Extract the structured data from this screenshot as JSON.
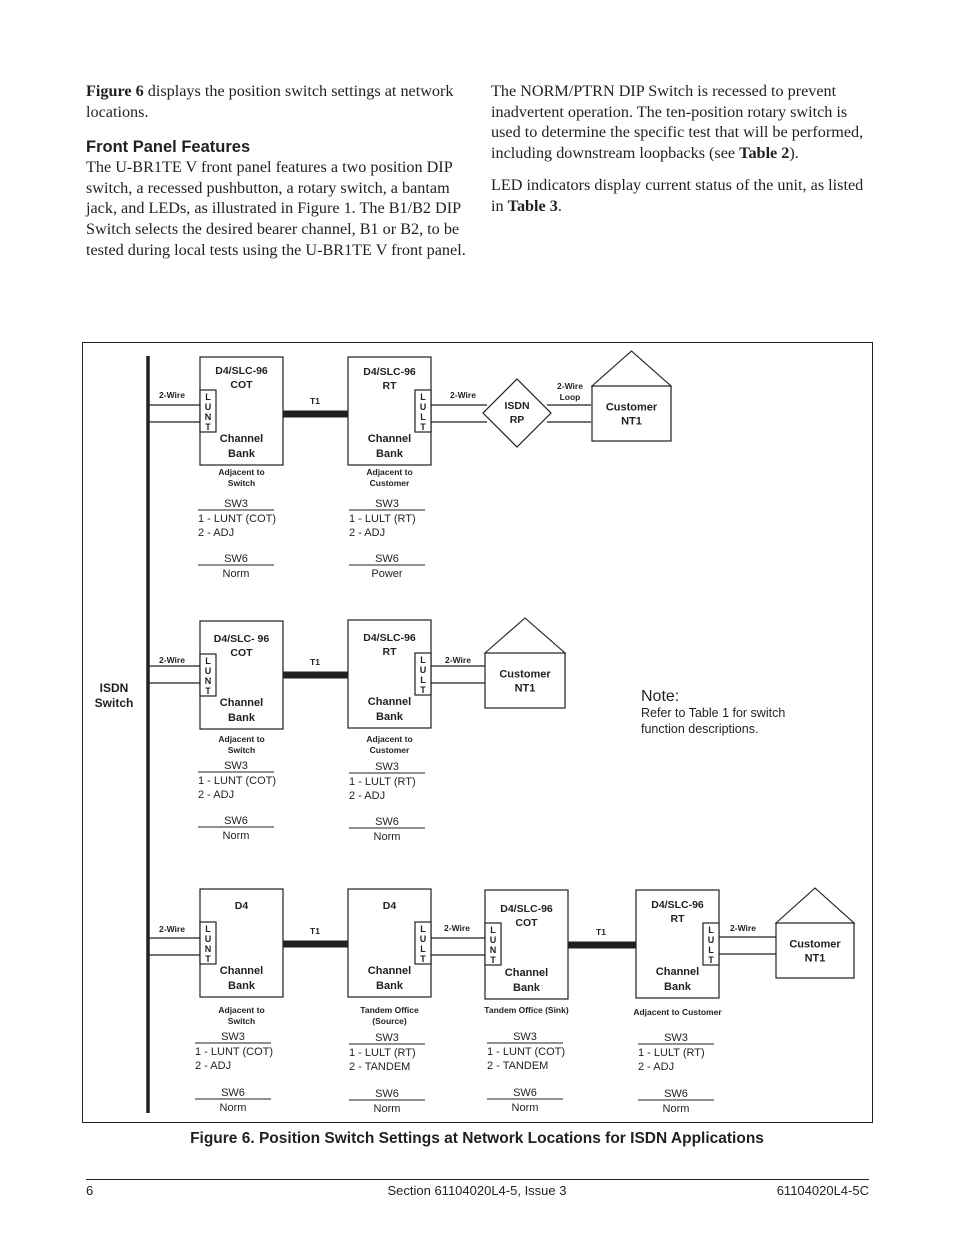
{
  "body_text": {
    "left_column": {
      "intro": {
        "bold": "Figure 6",
        "rest": " displays the position switch settings at network locations."
      },
      "heading": "Front Panel Features",
      "paragraph": "The U-BR1TE V front panel features a two position DIP switch, a recessed pushbutton, a rotary switch, a bantam jack, and LEDs, as illustrated in Figure 1. The B1/B2 DIP Switch selects the desired bearer channel, B1 or B2, to be tested during local tests using the U-BR1TE V front panel."
    },
    "right_column": {
      "p1_text": "The NORM/PTRN DIP Switch is recessed to prevent inadvertent operation.  The ten-position rotary switch is used to determine the specific test that will be performed, including downstream loopbacks (see ",
      "p1_bold": "Table 2",
      "p1_end": ").",
      "p2_text": "LED indicators display current status of the unit, as listed in ",
      "p2_bold": "Table 3",
      "p2_end": "."
    }
  },
  "figure": {
    "switch_label": [
      "ISDN",
      "Switch"
    ],
    "note_title": "Note:",
    "note_lines": [
      "Refer to Table 1 for switch",
      "function descriptions."
    ],
    "labels": {
      "two_wire": "2-Wire",
      "two_wire_loop": [
        "2-Wire",
        "Loop"
      ],
      "t1": "T1",
      "channel_bank": [
        "Channel",
        "Bank"
      ],
      "lunt": [
        "L",
        "U",
        "N",
        "T"
      ],
      "lult": [
        "L",
        "U",
        "L",
        "T"
      ],
      "isdn_rp": [
        "ISDN",
        "RP"
      ],
      "customer_nt1": [
        "Customer",
        "NT1"
      ]
    },
    "rows": [
      {
        "units": [
          {
            "title": [
              "D4/SLC-96",
              "COT"
            ],
            "card": "lunt",
            "location": [
              "Adjacent to",
              "Switch"
            ],
            "sw3_title": "SW3",
            "sw3": [
              "1 - LUNT (COT)",
              "2 - ADJ"
            ],
            "sw6_title": "SW6",
            "sw6": "Norm"
          },
          {
            "title": [
              "D4/SLC-96",
              "RT"
            ],
            "card": "lult",
            "location": [
              "Adjacent to",
              "Customer"
            ],
            "sw3_title": "SW3",
            "sw3": [
              "1 - LULT (RT)",
              "2 - ADJ"
            ],
            "sw6_title": "SW6",
            "sw6": "Power"
          }
        ],
        "has_rp": true
      },
      {
        "units": [
          {
            "title": [
              "D4/SLC- 96",
              "COT"
            ],
            "card": "lunt",
            "location": [
              "Adjacent to",
              "Switch"
            ],
            "sw3_title": "SW3",
            "sw3": [
              "1 - LUNT (COT)",
              "2 - ADJ"
            ],
            "sw6_title": "SW6",
            "sw6": "Norm"
          },
          {
            "title": [
              "D4/SLC-96",
              "RT"
            ],
            "card": "lult",
            "location": [
              "Adjacent to",
              "Customer"
            ],
            "sw3_title": "SW3",
            "sw3": [
              "1 - LULT (RT)",
              "2 - ADJ"
            ],
            "sw6_title": "SW6",
            "sw6": "Norm"
          }
        ],
        "has_rp": false
      },
      {
        "units": [
          {
            "title": [
              "D4"
            ],
            "card": "lunt",
            "location": [
              "Adjacent to",
              "Switch"
            ],
            "sw3_title": "SW3",
            "sw3": [
              "1 - LUNT (COT)",
              "2 - ADJ"
            ],
            "sw6_title": "SW6",
            "sw6": "Norm"
          },
          {
            "title": [
              "D4"
            ],
            "card": "lult",
            "location": [
              "Tandem Office",
              "(Source)"
            ],
            "sw3_title": "SW3",
            "sw3": [
              "1 - LULT (RT)",
              "2 - TANDEM"
            ],
            "sw6_title": "SW6",
            "sw6": "Norm"
          },
          {
            "title": [
              "D4/SLC-96",
              "COT"
            ],
            "card": "lunt",
            "location": [
              "Tandem Office (Sink)"
            ],
            "sw3_title": "SW3",
            "sw3": [
              "1 - LUNT (COT)",
              "2 - TANDEM"
            ],
            "sw6_title": "SW6",
            "sw6": "Norm"
          },
          {
            "title": [
              "D4/SLC-96",
              "RT"
            ],
            "card": "lult",
            "location": [
              "Adjacent to Customer"
            ],
            "sw3_title": "SW3",
            "sw3": [
              "1 - LULT (RT)",
              "2 - ADJ"
            ],
            "sw6_title": "SW6",
            "sw6": "Norm"
          }
        ],
        "has_rp": false
      }
    ]
  },
  "caption": "Figure 6.  Position Switch Settings at Network Locations for ISDN Applications",
  "footer": {
    "page": "6",
    "section": "Section 61104020L4-5, Issue 3",
    "doc_number": "61104020L4-5C"
  }
}
